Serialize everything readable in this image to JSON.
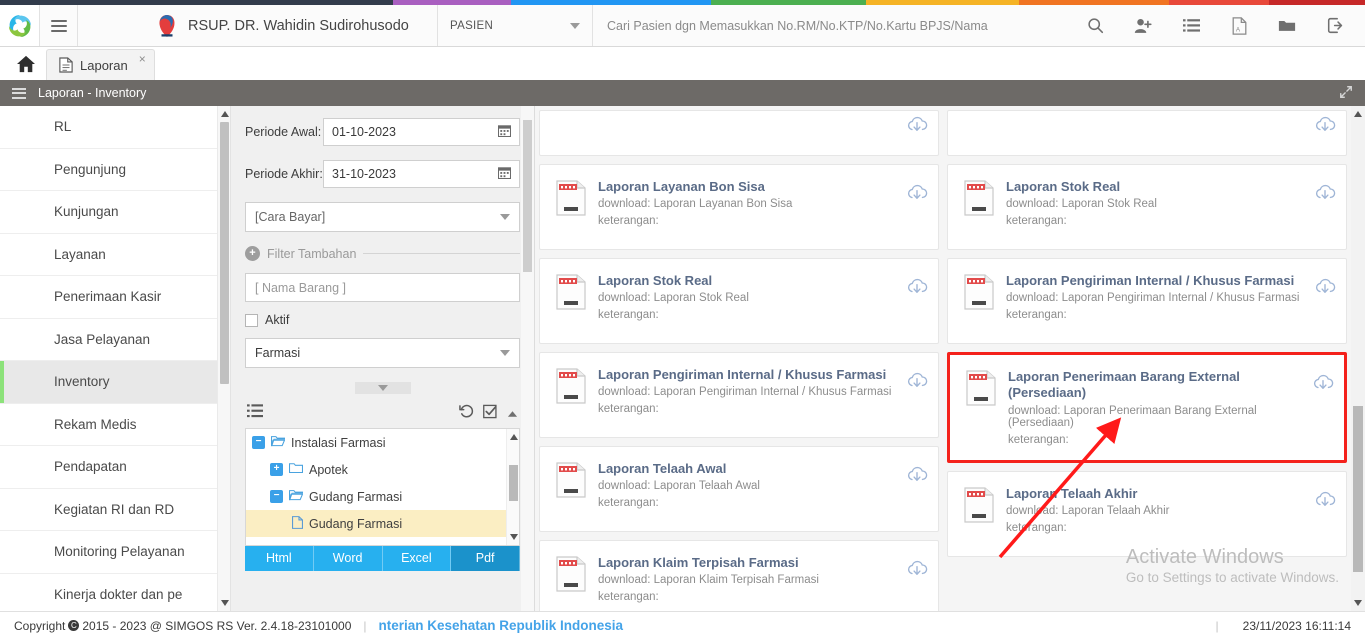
{
  "topstrip": {
    "colors": [
      "#323c4c",
      "#a95fc0",
      "#2196f3",
      "#4caf50",
      "#f5b325",
      "#f07422",
      "#e8493a",
      "#c62828"
    ],
    "widths": [
      393,
      118,
      200,
      155,
      153,
      150,
      100,
      96
    ]
  },
  "header": {
    "logo_icon": "simgos-logo-icon",
    "menu_icon": "hamburger-icon",
    "hospital_logo_icon": "hospital-logo-icon",
    "hospital_name": "RSUP. DR. Wahidin Sudirohusodo",
    "category_select": "PASIEN",
    "search_placeholder": "Cari Pasien dgn Memasukkan No.RM/No.KTP/No.Kartu BPJS/Nama",
    "search_value": "",
    "icons": [
      {
        "name": "search-icon",
        "glyph": "⌕"
      },
      {
        "name": "add-user-icon",
        "glyph": "👤"
      },
      {
        "name": "list-icon",
        "glyph": "☰"
      },
      {
        "name": "pdf-icon",
        "glyph": "🗎"
      },
      {
        "name": "folder-icon",
        "glyph": "🗀"
      },
      {
        "name": "logout-icon",
        "glyph": "⇥"
      }
    ]
  },
  "tabs": {
    "home_icon": "home-icon",
    "items": [
      {
        "label": "Laporan",
        "icon": "document-icon",
        "close": "×",
        "active": true
      }
    ]
  },
  "breadcrumb": {
    "title": "Laporan - Inventory",
    "menu_icon": "list-bars-icon",
    "expand_icon": "expand-icon"
  },
  "sidebar": {
    "items": [
      {
        "label": "RL",
        "active": false
      },
      {
        "label": "Pengunjung",
        "active": false
      },
      {
        "label": "Kunjungan",
        "active": false
      },
      {
        "label": "Layanan",
        "active": false
      },
      {
        "label": "Penerimaan Kasir",
        "active": false
      },
      {
        "label": "Jasa Pelayanan",
        "active": false
      },
      {
        "label": "Inventory",
        "active": true
      },
      {
        "label": "Rekam Medis",
        "active": false
      },
      {
        "label": "Pendapatan",
        "active": false
      },
      {
        "label": "Kegiatan RI dan RD",
        "active": false
      },
      {
        "label": "Monitoring Pelayanan",
        "active": false
      },
      {
        "label": "Kinerja dokter dan pe",
        "active": false
      }
    ]
  },
  "filters": {
    "periode_awal_label": "Periode Awal:",
    "periode_awal_value": "01-10-2023",
    "periode_akhir_label": "Periode Akhir:",
    "periode_akhir_value": "31-10-2023",
    "cara_bayar_value": "[Cara Bayar]",
    "filter_tambahan_label": "Filter Tambahan",
    "nama_barang_placeholder": "[ Nama Barang ]",
    "nama_barang_value": "[ Nama Barang ]",
    "aktif_label": "Aktif",
    "aktif_checked": false,
    "unit_value": "Farmasi",
    "calendar_icon": "calendar-icon",
    "toolbar": {
      "list_icon": "list-icon",
      "history_icon": "history-icon",
      "checkall_icon": "check-square-icon",
      "collapse_icon": "caret-up-icon"
    },
    "tree": [
      {
        "label": "Instalasi Farmasi",
        "level": 1,
        "toggle": "−",
        "icon": "folder-open-icon",
        "selected": false
      },
      {
        "label": "Apotek",
        "level": 2,
        "toggle": "+",
        "icon": "folder-icon",
        "selected": false
      },
      {
        "label": "Gudang Farmasi",
        "level": 2,
        "toggle": "−",
        "icon": "folder-open-icon",
        "selected": false
      },
      {
        "label": "Gudang Farmasi",
        "level": 3,
        "toggle": "",
        "icon": "file-icon",
        "selected": true
      }
    ],
    "export_buttons": [
      {
        "label": "Html",
        "active": false
      },
      {
        "label": "Word",
        "active": false
      },
      {
        "label": "Excel",
        "active": false
      },
      {
        "label": "Pdf",
        "active": true
      }
    ]
  },
  "reports": {
    "download_prefix": "download: ",
    "keterangan_label": "keterangan:",
    "download_icon": "cloud-download-icon",
    "doc_icon": "report-document-icon",
    "col_left": [
      {
        "title": "",
        "download": "",
        "clipped": true
      },
      {
        "title": "Laporan Layanan Bon Sisa",
        "download": "Laporan Layanan Bon Sisa"
      },
      {
        "title": "Laporan Stok Real",
        "download": "Laporan Stok Real"
      },
      {
        "title": "Laporan Pengiriman Internal / Khusus Farmasi",
        "download": "Laporan Pengiriman Internal / Khusus Farmasi"
      },
      {
        "title": "Laporan Telaah Awal",
        "download": "Laporan Telaah Awal"
      },
      {
        "title": "Laporan Klaim Terpisah Farmasi",
        "download": "Laporan Klaim Terpisah Farmasi"
      }
    ],
    "col_right": [
      {
        "title": "",
        "download": "",
        "clipped": true
      },
      {
        "title": "Laporan Stok Real",
        "download": "Laporan Stok Real"
      },
      {
        "title": "Laporan Pengiriman Internal / Khusus Farmasi",
        "download": "Laporan Pengiriman Internal / Khusus Farmasi"
      },
      {
        "title": "Laporan Penerimaan Barang External (Persediaan)",
        "download": "Laporan Penerimaan Barang External (Persediaan)",
        "highlight": true
      },
      {
        "title": "Laporan Telaah Akhir",
        "download": "Laporan Telaah Akhir"
      }
    ]
  },
  "watermark": {
    "line1": "Activate Windows",
    "line2": "Go to Settings to activate Windows."
  },
  "footer": {
    "copyright_label": "Copyright",
    "copyright_text": "2015 - 2023 @ SIMGOS RS Ver. 2.4.18-23101000",
    "ministry": "nterian Kesehatan Republik Indonesia",
    "datetime": "23/11/2023 16:11:14"
  },
  "colors": {
    "accent_blue": "#27b0ef",
    "highlight_red": "#f4211b",
    "active_green": "#8ce27a",
    "breadcrumb_gray": "#6d6a67",
    "card_title": "#5a6b87"
  }
}
